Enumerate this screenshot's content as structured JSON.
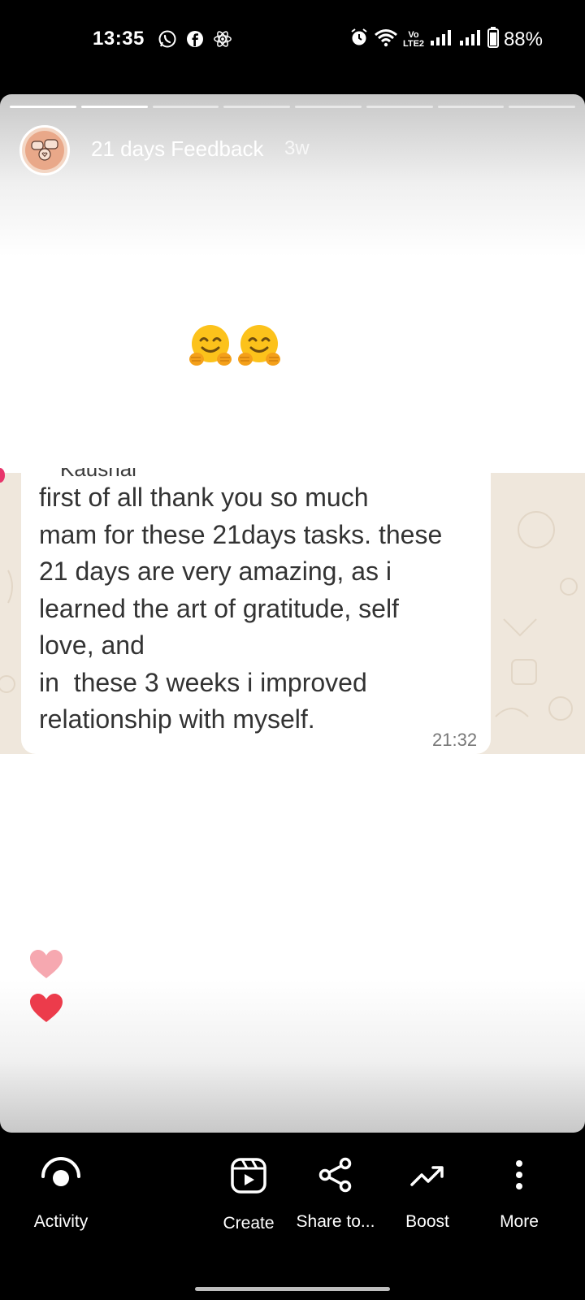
{
  "status_bar": {
    "time": "13:35",
    "battery": "88%",
    "network_label": "Vo LTE2"
  },
  "story": {
    "progress_segments": [
      1,
      1,
      0,
      0,
      0,
      0,
      0,
      0
    ],
    "account_name": "21 days Feedback",
    "posted_ago": "3w",
    "emoji": [
      "hugging-face",
      "hugging-face"
    ],
    "chat": {
      "sender_name": "Kaushal",
      "message": "first of all thank you so much mam for these 21days tasks. these 21 days are very amazing, as i learned the art of gratitude, self love, and\nin  these 3 weeks i improved relationship with myself.",
      "time": "21:32"
    }
  },
  "actions": {
    "activity": "Activity",
    "create": "Create",
    "share": "Share to...",
    "boost": "Boost",
    "more": "More"
  },
  "colors": {
    "heart_light": "#f6a8b0",
    "heart_dark": "#ec3b4b",
    "chat_bg": "#efe7dc"
  }
}
